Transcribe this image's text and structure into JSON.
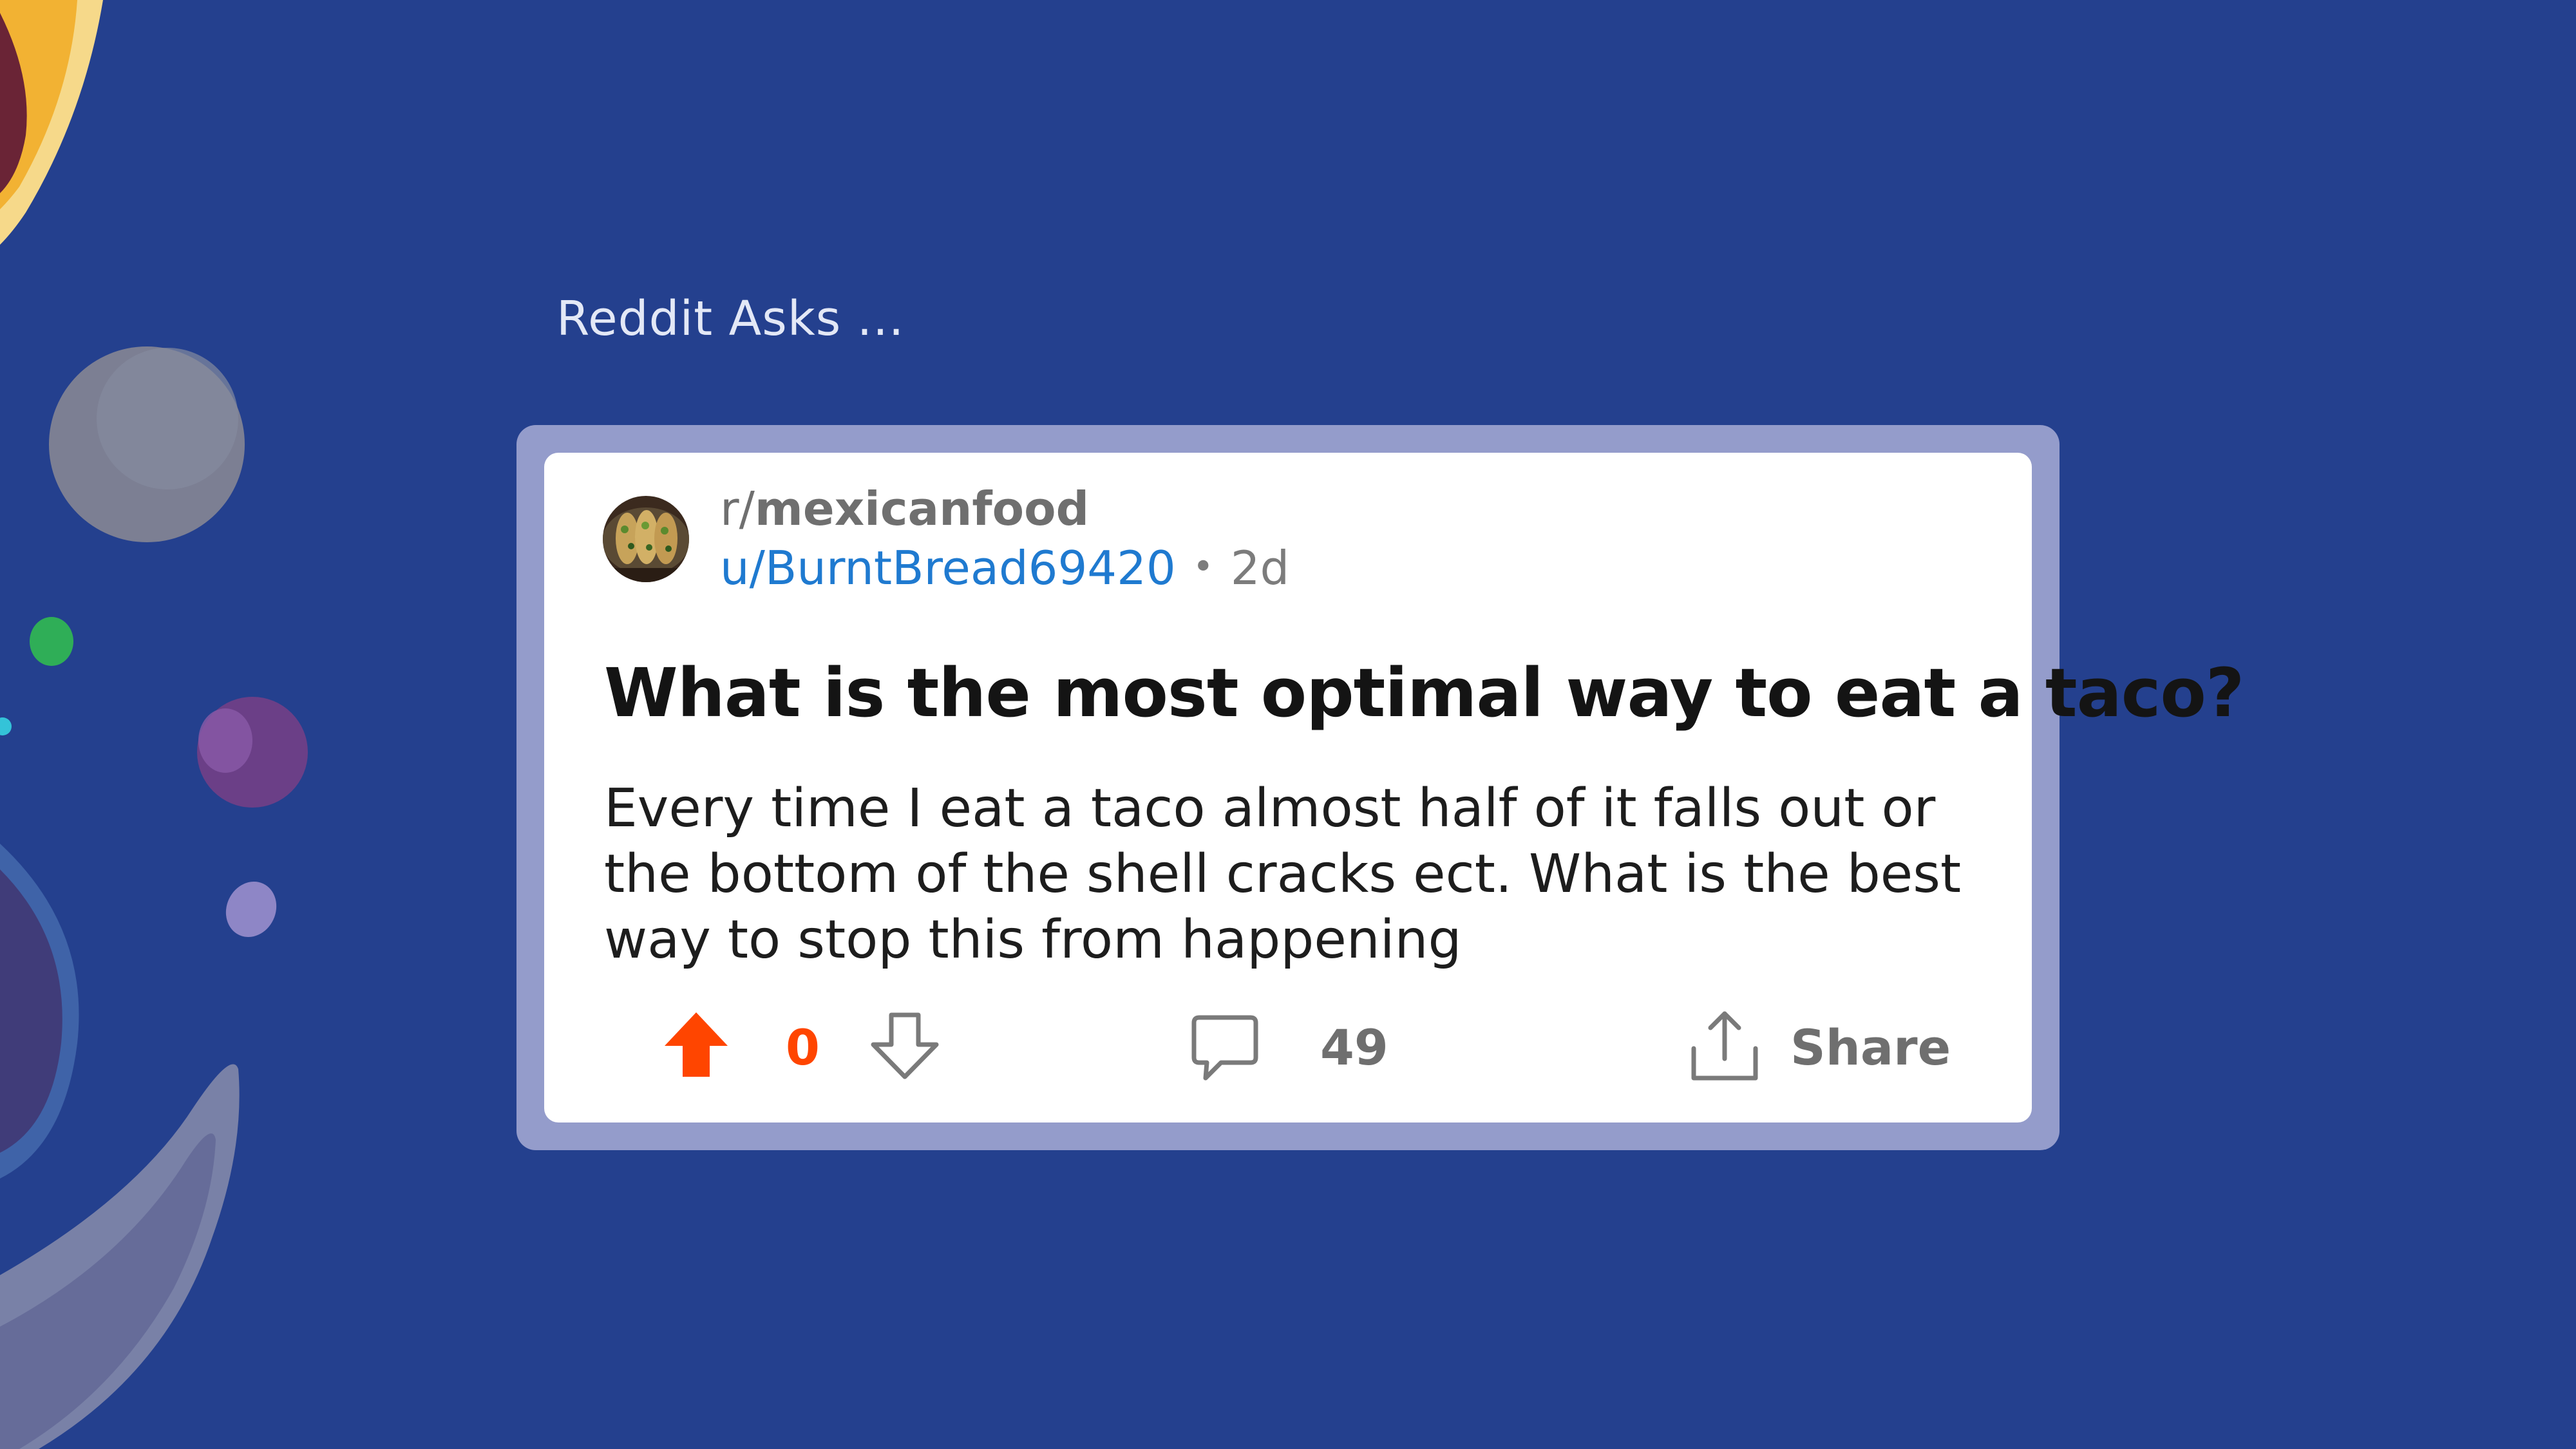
{
  "kicker": "Reddit Asks ...",
  "post": {
    "subreddit_prefix": "r/",
    "subreddit_name": "mexicanfood",
    "author": "u/BurntBread69420",
    "separator": "•",
    "age": "2d",
    "title": "What is the most optimal way to eat a taco?",
    "body": "Every time I eat a taco almost half of it falls out or the bottom of the shell cracks ect. What is the best way to stop this from happening"
  },
  "actions": {
    "score": "0",
    "comments": "49",
    "share_label": "Share"
  },
  "icons": {
    "upvote": "upvote-arrow-icon",
    "downvote": "downvote-arrow-icon",
    "comment": "comment-bubble-icon",
    "share": "share-upload-icon"
  },
  "colors": {
    "background": "#24408e",
    "frame": "#949ccb",
    "card": "#ffffff",
    "upvote_active": "#ff4500",
    "username_link": "#1f7ad0",
    "muted_text": "#6f6f6f"
  }
}
